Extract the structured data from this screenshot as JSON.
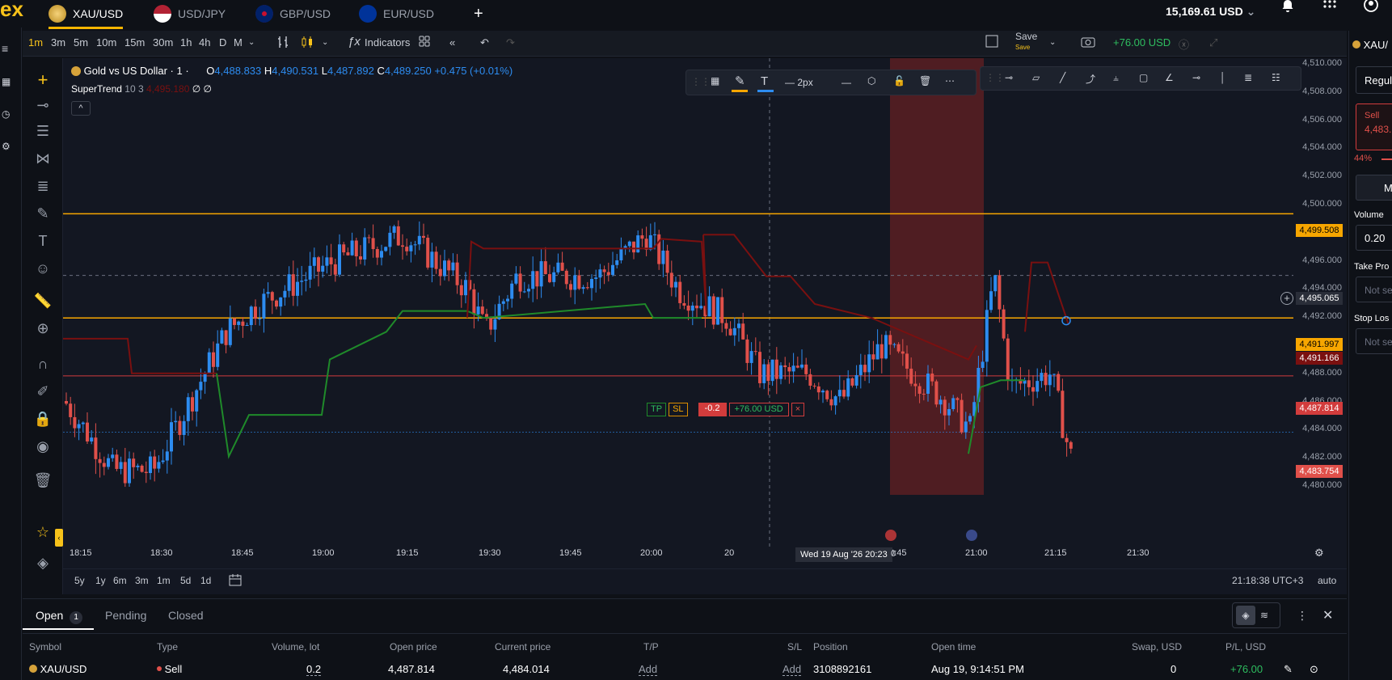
{
  "brand": {
    "logo_text": "ex",
    "accent": "#f7c21a"
  },
  "tabs": [
    {
      "label": "XAU/USD",
      "active": true
    },
    {
      "label": "USD/JPY",
      "active": false
    },
    {
      "label": "GBP/USD",
      "active": false
    },
    {
      "label": "EUR/USD",
      "active": false
    }
  ],
  "header": {
    "add": "+",
    "balance": "15,169.61 USD",
    "balance_chevron": "⌄"
  },
  "toolbar": {
    "timeframes": [
      "1m",
      "3m",
      "5m",
      "10m",
      "15m",
      "30m",
      "1h",
      "4h",
      "D",
      "M"
    ],
    "indicators_label": "Indicators",
    "save_label": "Save",
    "save_sub": "Save",
    "pnl_badge": "+76.00 USD"
  },
  "legend": {
    "symbol_name": "Gold vs US Dollar · 1 ·",
    "o_label": "O",
    "o": "4,488.833",
    "h_label": "H",
    "h": "4,490.531",
    "l_label": "L",
    "l": "4,487.892",
    "c_label": "C",
    "c": "4,489.250",
    "change": "+0.475 (+0.01%)",
    "indicator": "SuperTrend",
    "indicator_params": "10 3",
    "indicator_value": "4,495.180",
    "indicator_extra": "∅ ∅"
  },
  "drawing_toolbar": {
    "width_label": "2px"
  },
  "y_axis": {
    "ticks": [
      "4,510.000",
      "4,508.000",
      "4,506.000",
      "4,504.000",
      "4,502.000",
      "4,500.000",
      "4,498.000",
      "4,496.000",
      "4,494.000",
      "4,492.000",
      "4,490.000",
      "4,488.000",
      "4,486.000",
      "4,484.000",
      "4,482.000",
      "4,480.000"
    ],
    "tag_top_line": "4,499.508",
    "tag_crosshair": "4,495.065",
    "tag_mid_line": "4,491.997",
    "tag_supertrend": "4,491.166",
    "tag_entry": "4,487.814",
    "tag_current": "4,483.754"
  },
  "x_axis": {
    "ticks": [
      "18:15",
      "18:30",
      "18:45",
      "19:00",
      "19:15",
      "19:30",
      "19:45",
      "20:00",
      "20",
      "20:45",
      "21:00",
      "21:15",
      "21:30"
    ],
    "crosshair_label": "Wed 19 Aug '26   20:23",
    "crosshair_suffix": "0"
  },
  "position_line": {
    "tp": "TP",
    "sl": "SL",
    "volume": "-0.2",
    "pnl": "+76.00 USD",
    "close": "×"
  },
  "range_bar": {
    "ranges": [
      "5y",
      "1y",
      "6m",
      "3m",
      "1m",
      "5d",
      "1d"
    ],
    "clock": "21:18:38 UTC+3",
    "scale_mode": "auto"
  },
  "right_panel": {
    "symbol": "XAU/",
    "order_type": "Regula",
    "sell_label": "Sell",
    "sell_price": "4,483.",
    "sentiment": "44%",
    "m_label": "M",
    "volume_label": "Volume",
    "volume_value": "0.20",
    "tp_label": "Take Pro",
    "tp_placeholder": "Not se",
    "sl_label": "Stop Los",
    "sl_placeholder": "Not se"
  },
  "bottom": {
    "tabs": [
      {
        "label": "Open",
        "count": "1"
      },
      {
        "label": "Pending"
      },
      {
        "label": "Closed"
      }
    ],
    "columns": [
      "Symbol",
      "Type",
      "Volume, lot",
      "Open price",
      "Current price",
      "T/P",
      "S/L",
      "Position",
      "Open time",
      "Swap, USD",
      "P/L, USD"
    ],
    "row": {
      "symbol": "XAU/USD",
      "type": "Sell",
      "volume": "0.2",
      "open_price": "4,487.814",
      "current_price": "4,484.014",
      "tp": "Add",
      "sl": "Add",
      "position": "3108892161",
      "open_time": "Aug 19, 9:14:51 PM",
      "swap": "0",
      "pl": "+76.00"
    }
  },
  "colors": {
    "bull": "#2d8cf0",
    "bear": "#e0504a",
    "orange_line": "#f7a600",
    "red_line": "#d23c3c",
    "supertrend_up": "#1f8a2a",
    "supertrend_down": "#7a1010",
    "highlight": "#5a1e22",
    "green_text": "#2ebd5f"
  }
}
